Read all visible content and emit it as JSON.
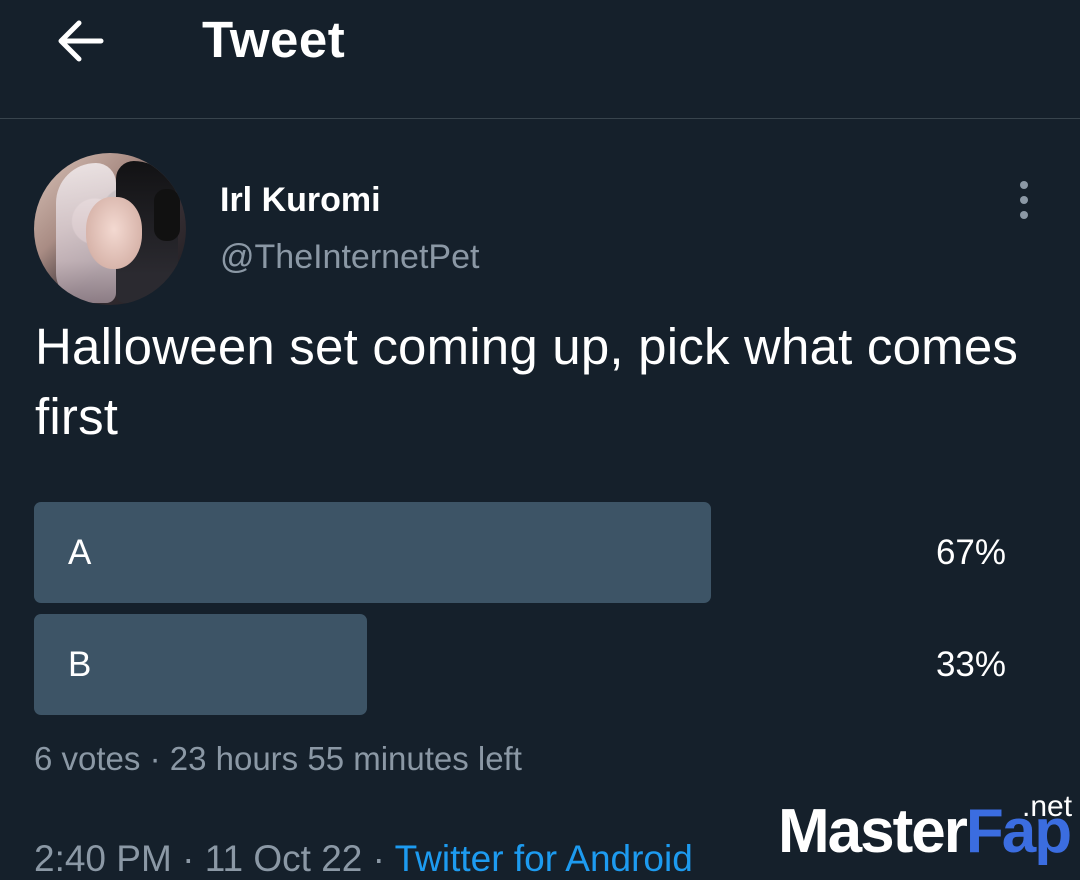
{
  "header": {
    "title": "Tweet",
    "back_icon": "arrow-left-icon"
  },
  "author": {
    "display_name": "Irl Kuromi",
    "handle": "@TheInternetPet",
    "avatar": "avatar-photo"
  },
  "more_icon": "more-vertical-icon",
  "tweet": {
    "text": "Halloween set coming up, pick what comes first"
  },
  "poll": {
    "options": [
      {
        "label": "A",
        "percent_text": "67%",
        "percent": 67
      },
      {
        "label": "B",
        "percent_text": "33%",
        "percent": 33
      }
    ],
    "votes": "6 votes",
    "separator": "·",
    "time_left": "23 hours 55 minutes left"
  },
  "meta": {
    "time": "2:40 PM",
    "date": "11 Oct 22",
    "separator": "·",
    "source": "Twitter for Android"
  },
  "watermark": {
    "part_a": "Master",
    "part_b": "Fap",
    "suffix": ".net"
  },
  "colors": {
    "background": "#15202b",
    "divider": "#38444d",
    "poll_fill": "#3d5466",
    "secondary_text": "#8b98a5",
    "link": "#1d9bf0"
  }
}
